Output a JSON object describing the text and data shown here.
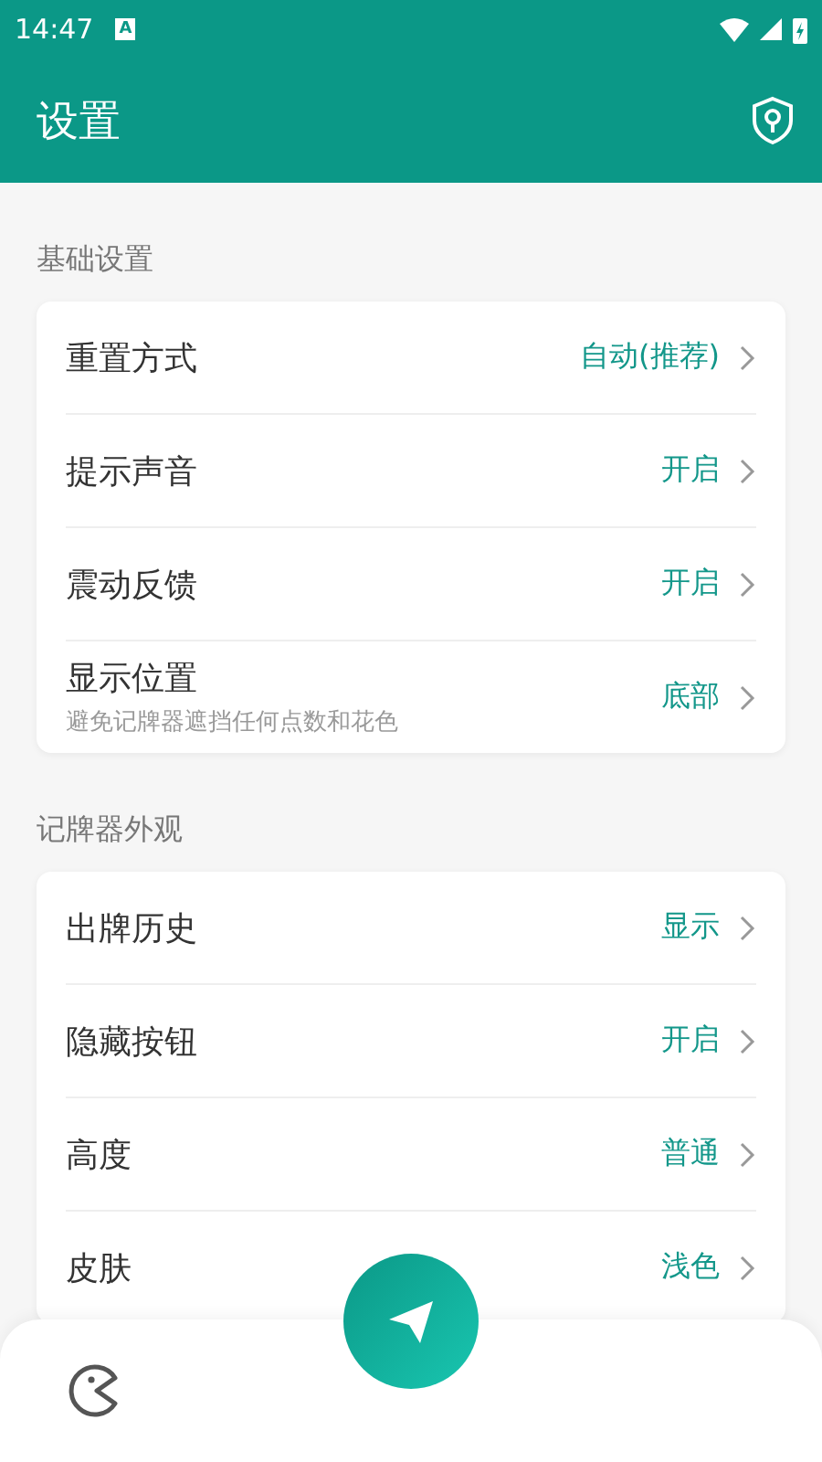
{
  "status_bar": {
    "time": "14:47",
    "notification": "A"
  },
  "app_bar": {
    "title": "设置"
  },
  "sections": [
    {
      "title": "基础设置",
      "items": [
        {
          "label": "重置方式",
          "value": "自动(推荐)"
        },
        {
          "label": "提示声音",
          "value": "开启"
        },
        {
          "label": "震动反馈",
          "value": "开启"
        },
        {
          "label": "显示位置",
          "hint": "避免记牌器遮挡任何点数和花色",
          "value": "底部"
        }
      ]
    },
    {
      "title": "记牌器外观",
      "items": [
        {
          "label": "出牌历史",
          "value": "显示"
        },
        {
          "label": "隐藏按钮",
          "value": "开启"
        },
        {
          "label": "高度",
          "value": "普通"
        },
        {
          "label": "皮肤",
          "value": "浅色"
        }
      ]
    }
  ]
}
